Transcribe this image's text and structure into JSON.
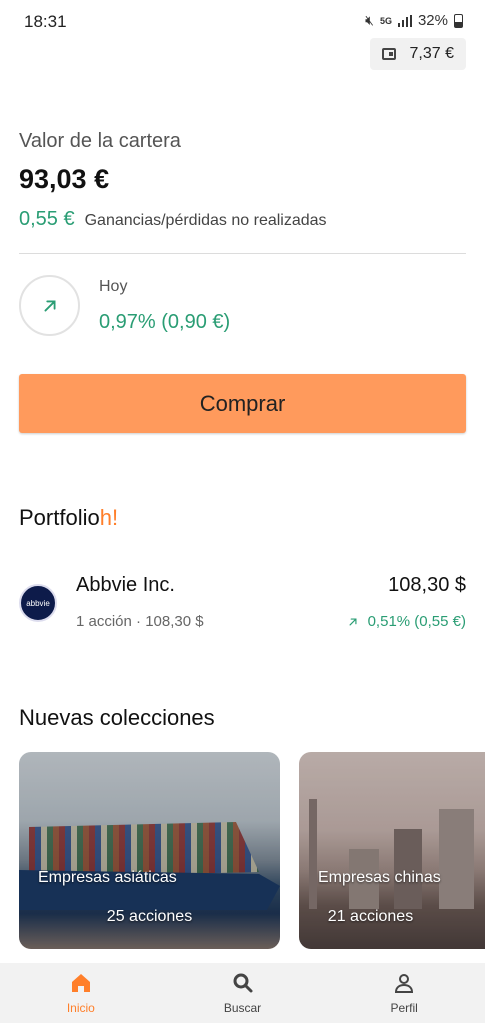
{
  "status_bar": {
    "time": "18:31",
    "network": "5G",
    "battery": "32%"
  },
  "wallet": {
    "balance": "7,37 €",
    "icon": "wallet-icon"
  },
  "portfolio": {
    "value_label": "Valor de la cartera",
    "value_amount": "93,03 €",
    "unrealized_amount": "0,55 €",
    "unrealized_label": "Ganancias/pérdidas no realizadas",
    "today_label": "Hoy",
    "today_value": "0,97% (0,90 €)",
    "today_icon": "arrow-up-right-icon"
  },
  "buy_button": {
    "label": "Comprar"
  },
  "portfolioh": {
    "title_main": "Portfolio",
    "title_accent": "h!"
  },
  "holdings": [
    {
      "name": "Abbvie Inc.",
      "logo_text": "abbvie",
      "shares": "1 acción · 108,30 $",
      "price": "108,30 $",
      "change": "0,51% (0,55 €)"
    }
  ],
  "collections": {
    "title": "Nuevas colecciones",
    "items": [
      {
        "title": "Empresas asiáticas",
        "count": "25 acciones"
      },
      {
        "title": "Empresas chinas",
        "count": "21 acciones"
      }
    ]
  },
  "bottom_nav": {
    "items": [
      {
        "label": "Inicio",
        "icon": "home-icon",
        "active": true
      },
      {
        "label": "Buscar",
        "icon": "search-icon",
        "active": false
      },
      {
        "label": "Perfil",
        "icon": "profile-icon",
        "active": false
      }
    ]
  },
  "colors": {
    "accent": "#ff7f2a",
    "buy_button": "#ff9a5c",
    "positive": "#2a9d74"
  }
}
